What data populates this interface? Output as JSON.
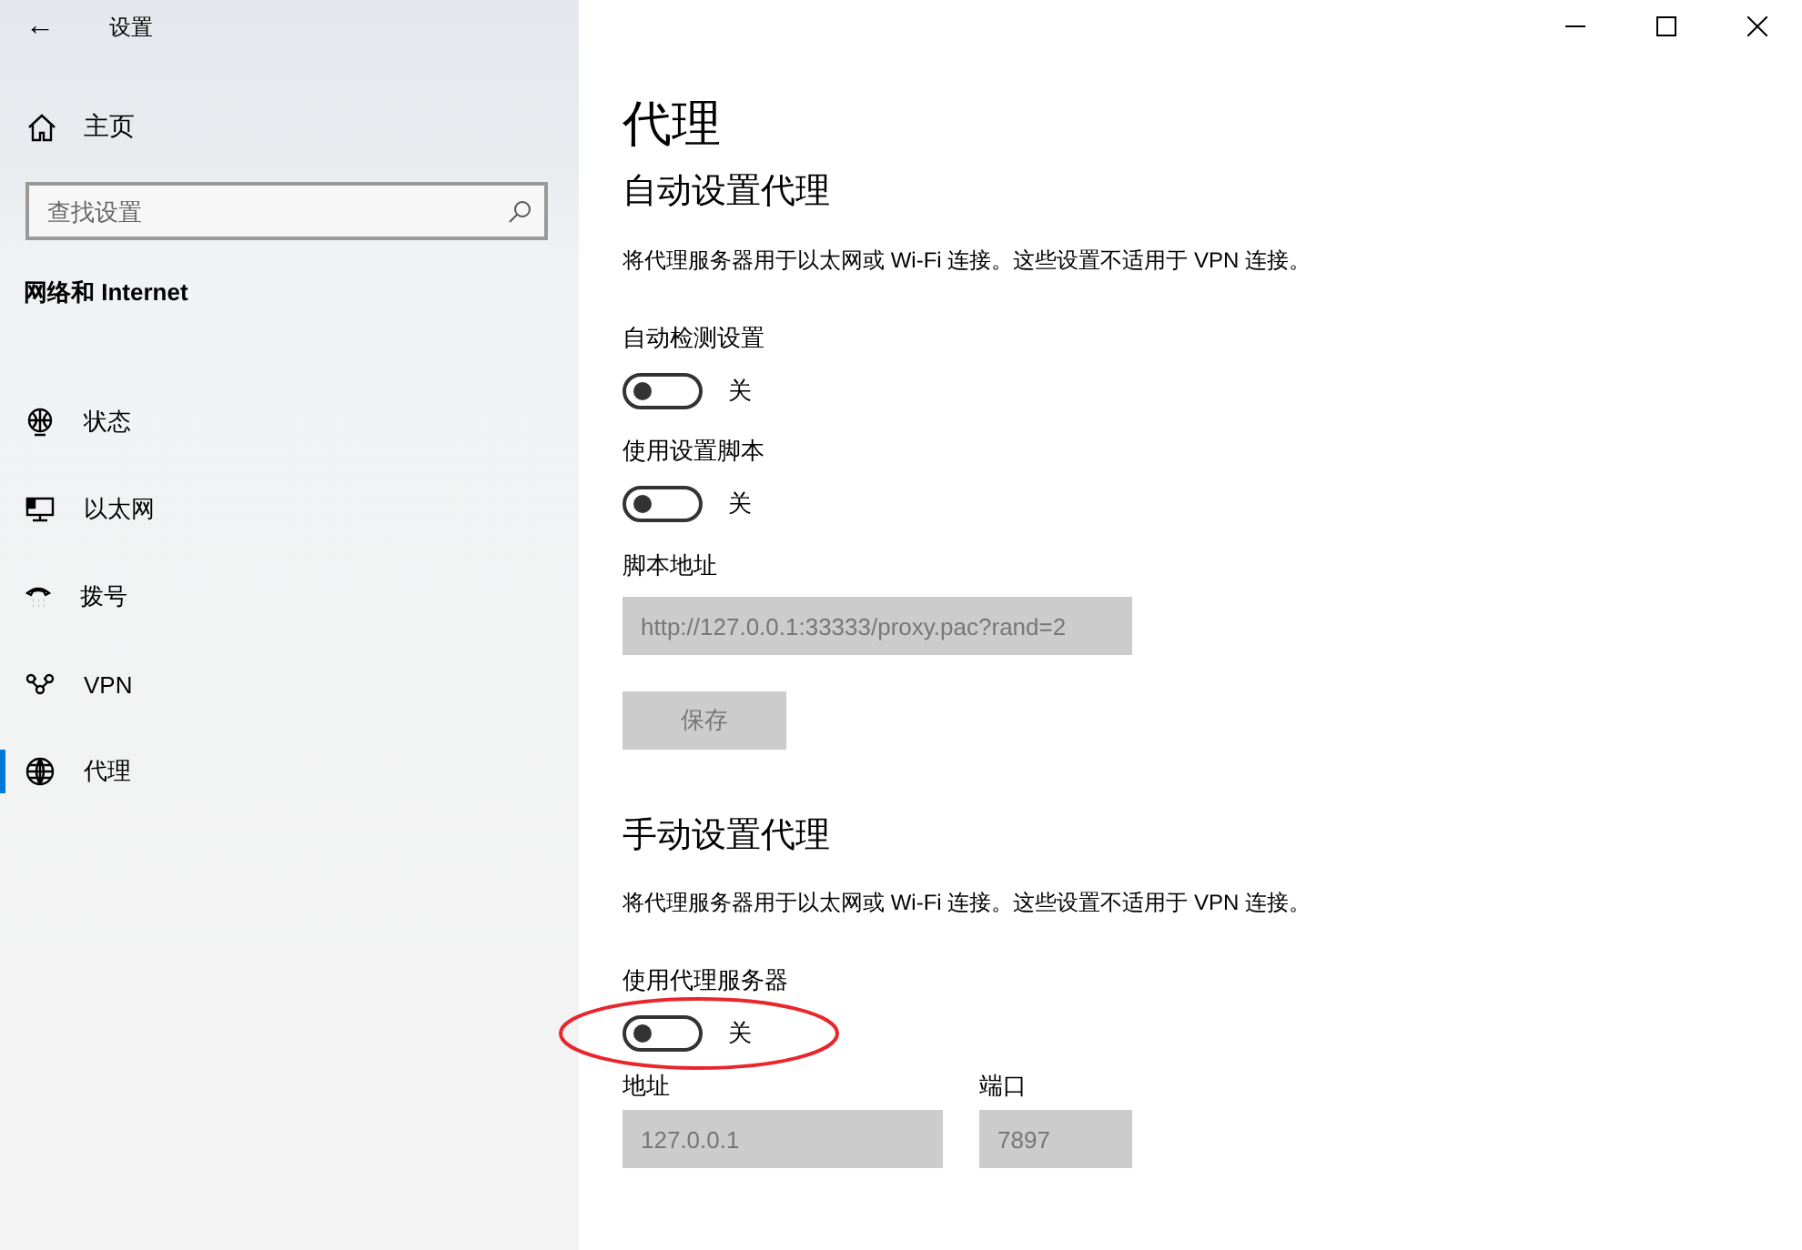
{
  "window": {
    "title": "设置",
    "back": "←"
  },
  "sidebar": {
    "home": "主页",
    "search": {
      "placeholder": "查找设置"
    },
    "section": "网络和 Internet",
    "items": [
      {
        "label": "状态",
        "kind": "status",
        "selected": false
      },
      {
        "label": "以太网",
        "kind": "ethernet",
        "selected": false
      },
      {
        "label": "拨号",
        "kind": "dialup",
        "selected": false
      },
      {
        "label": "VPN",
        "kind": "vpn",
        "selected": false
      },
      {
        "label": "代理",
        "kind": "proxy",
        "selected": true
      }
    ]
  },
  "page": {
    "title": "代理",
    "auto": {
      "heading": "自动设置代理",
      "description": "将代理服务器用于以太网或 Wi-Fi 连接。这些设置不适用于 VPN 连接。",
      "toggles": [
        {
          "label": "自动检测设置",
          "on": false,
          "state": "关"
        },
        {
          "label": "使用设置脚本",
          "on": false,
          "state": "关"
        }
      ],
      "script": {
        "label": "脚本地址",
        "value": "http://127.0.0.1:33333/proxy.pac?rand=2",
        "disabled": true
      },
      "save": {
        "label": "保存",
        "disabled": true
      }
    },
    "manual": {
      "heading": "手动设置代理",
      "description": "将代理服务器用于以太网或 Wi-Fi 连接。这些设置不适用于 VPN 连接。",
      "toggle": {
        "label": "使用代理服务器",
        "on": false,
        "state": "关",
        "annotated": true
      },
      "address": {
        "label": "地址",
        "value": "127.0.0.1",
        "disabled": true
      },
      "port": {
        "label": "端口",
        "value": "7897",
        "disabled": true
      }
    }
  }
}
